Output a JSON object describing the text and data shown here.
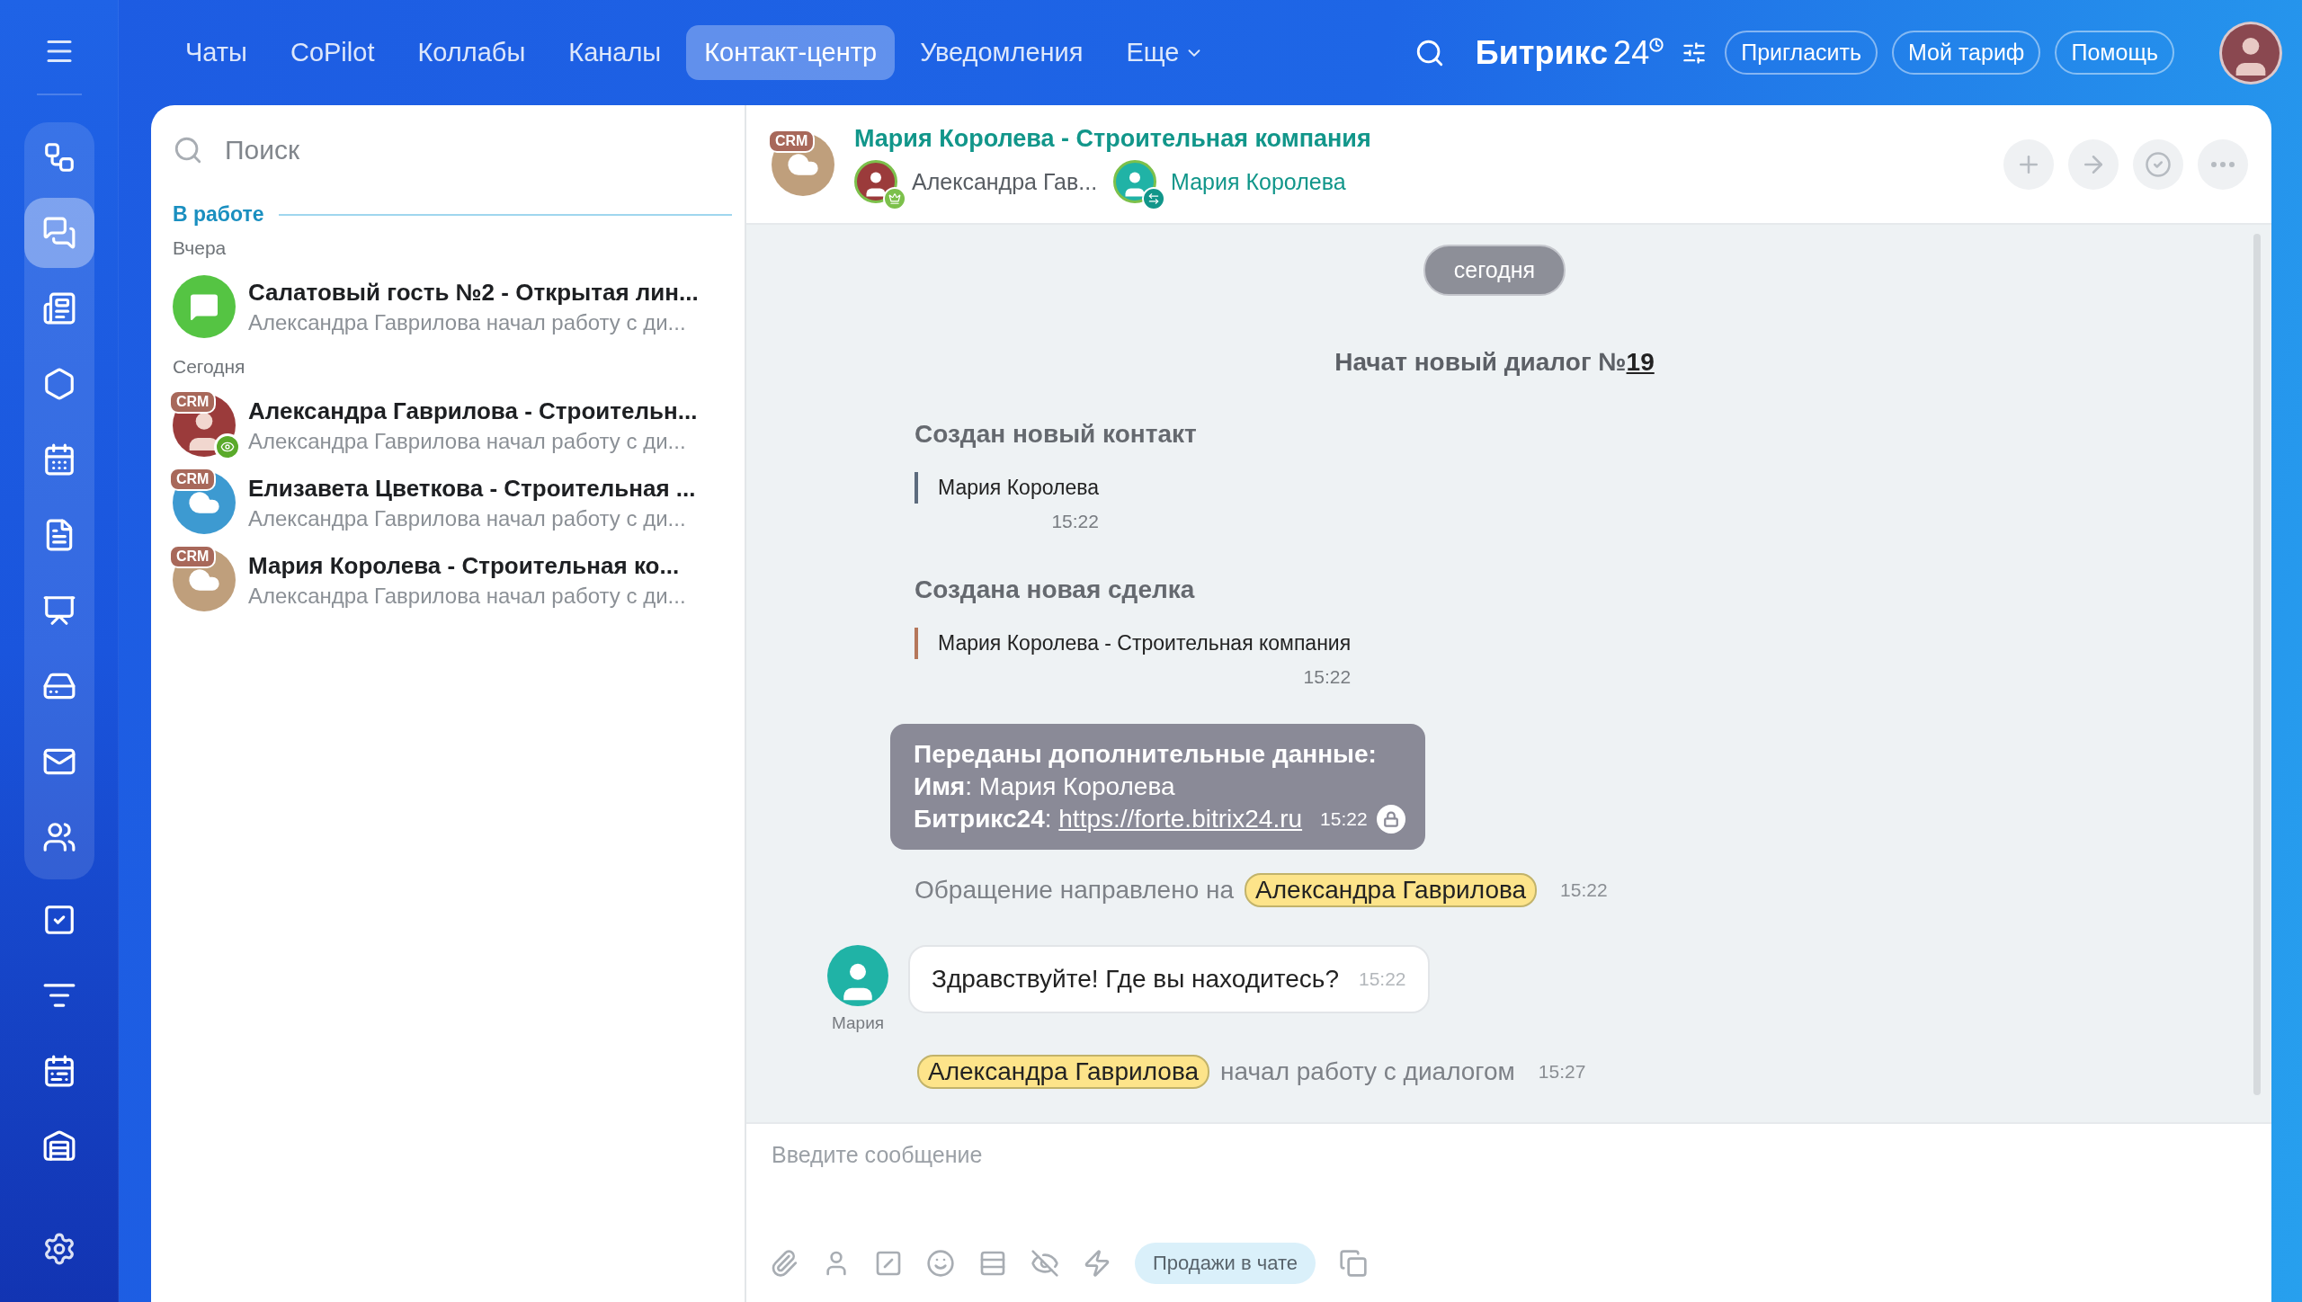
{
  "nav": {
    "tabs": [
      {
        "label": "Чаты",
        "selected": false
      },
      {
        "label": "CoPilot",
        "selected": false
      },
      {
        "label": "Коллабы",
        "selected": false
      },
      {
        "label": "Каналы",
        "selected": false
      },
      {
        "label": "Контакт-центр",
        "selected": true
      },
      {
        "label": "Уведомления",
        "selected": false
      }
    ],
    "more": "Еще"
  },
  "brand": {
    "name": "Битрикс",
    "number": "24"
  },
  "header_buttons": [
    "Пригласить",
    "Мой тариф",
    "Помощь"
  ],
  "sidebar": {
    "group": [
      {
        "kind": "flow",
        "selected": false
      },
      {
        "kind": "chats",
        "selected": true
      },
      {
        "kind": "feed",
        "selected": false
      },
      {
        "kind": "hexagon",
        "selected": false
      },
      {
        "kind": "calendar",
        "selected": false
      },
      {
        "kind": "docs",
        "selected": false
      },
      {
        "kind": "board",
        "selected": false
      },
      {
        "kind": "drive",
        "selected": false
      },
      {
        "kind": "mail",
        "selected": false
      },
      {
        "kind": "people",
        "selected": false
      }
    ],
    "items": [
      {
        "kind": "tasks",
        "selected": false
      },
      {
        "kind": "funnel",
        "selected": false
      },
      {
        "kind": "schedule",
        "selected": false
      },
      {
        "kind": "warehouse",
        "selected": false
      }
    ]
  },
  "search": {
    "placeholder": "Поиск"
  },
  "section": "В работе",
  "groups": [
    {
      "label": "Вчера",
      "chats": [
        {
          "kind": "chat",
          "color": "#55c443",
          "title": "Салатовый гость №2 - Открытая лин...",
          "preview": "Александра Гаврилова начал работу с ди..."
        }
      ]
    },
    {
      "label": "Сегодня",
      "chats": [
        {
          "kind": "photo",
          "badge": "CRM",
          "status_badge": true,
          "title": "Александра Гаврилова - Строительн...",
          "preview": "Александра Гаврилова начал работу с ди..."
        },
        {
          "kind": "cloud",
          "color": "#3d9ad1",
          "badge": "CRM",
          "title": "Елизавета Цветкова - Строительная ...",
          "preview": "Александра Гаврилова начал работу с ди..."
        },
        {
          "kind": "cloud",
          "color": "#bf9f7c",
          "badge": "CRM",
          "title": "Мария Королева - Строительная ко...",
          "preview": "Александра Гаврилова начал работу с ди..."
        }
      ]
    }
  ],
  "chat": {
    "title": "Мария Королева - Строительная компания",
    "badge": "CRM",
    "color": "#bf9f7c",
    "members": [
      {
        "kind": "operator",
        "name": "Александра Гав..."
      },
      {
        "kind": "client",
        "name": "Мария Королева"
      }
    ],
    "date": "сегодня",
    "messages": [
      {
        "kind": "dialog-start",
        "text": "Начат новый диалог №",
        "link": "19"
      },
      {
        "kind": "entity",
        "title": "Создан новый контакт",
        "value": "Мария Королева",
        "time": "15:22",
        "color": "#5c6b7d"
      },
      {
        "kind": "entity",
        "title": "Создана новая сделка",
        "value": "Мария Королева - Строительная компания",
        "time": "15:22",
        "color": "#b5775a"
      },
      {
        "kind": "data",
        "heading": "Переданы дополнительные данные:",
        "lines": [
          "**Имя**: Мария Королева"
        ],
        "link_label": "**Битрикс24**: ",
        "link": "https://forte.bitrix24.ru",
        "time": "15:22"
      },
      {
        "kind": "routed",
        "text": "Обращение направлено на",
        "mention": "Александра Гаврилова",
        "time": "15:22"
      },
      {
        "kind": "incoming",
        "author": "Мария",
        "text": "Здравствуйте! Где вы находитесь?",
        "time": "15:22"
      },
      {
        "kind": "started",
        "mention": "Александра Гаврилова",
        "text": "начал работу с диалогом",
        "time": "15:27"
      }
    ]
  },
  "composer": {
    "placeholder": "Введите сообщение",
    "tools": [
      {
        "kind": "attach"
      },
      {
        "kind": "contact"
      },
      {
        "kind": "command"
      },
      {
        "kind": "emoji"
      },
      {
        "kind": "template"
      },
      {
        "kind": "hidden"
      },
      {
        "kind": "quick"
      },
      {
        "kind": "sales"
      },
      {
        "kind": "panels"
      }
    ],
    "sales_button": "Продажи в чате"
  }
}
